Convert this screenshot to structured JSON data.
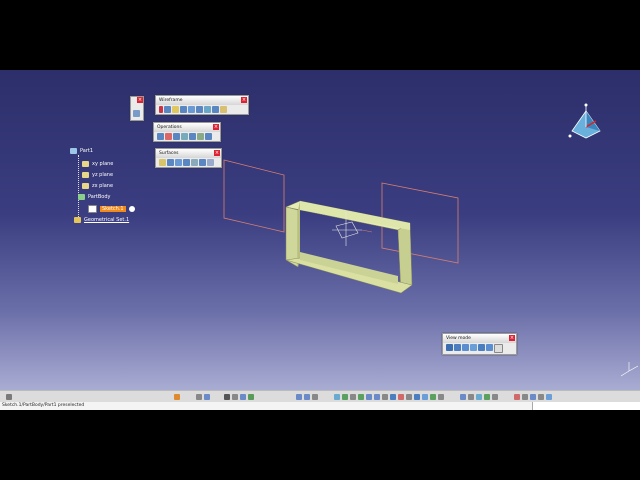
{
  "tree": {
    "root": "Part1",
    "xy_plane": "xy plane",
    "yz_plane": "yz plane",
    "zx_plane": "zx plane",
    "part_body": "PartBody",
    "sketch": "Sketch.1",
    "geo_set": "Geometrical Set.1"
  },
  "toolbars": {
    "wireframe": "Wireframe",
    "operations": "Operations",
    "surfaces": "Surfaces",
    "view_mode": "View mode",
    "close": "×"
  },
  "status": {
    "prompt": "Sketch.1/PartBody/Part1 preselected"
  },
  "colors": {
    "background_top": "#2d2f6b",
    "background_bottom": "#a9acd2",
    "surface_fill": "#d9e0a2",
    "highlight": "#f08a1c",
    "plane_edge": "#d98070"
  },
  "icons": {
    "tree_root": "part-icon",
    "plane": "plane-icon",
    "body": "body-icon",
    "sketch": "sketch-icon",
    "geoset": "geometrical-set-icon",
    "compass": "compass-icon"
  }
}
